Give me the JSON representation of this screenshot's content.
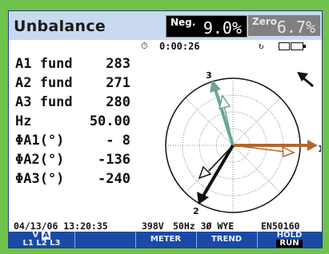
{
  "header": {
    "title": "Unbalance",
    "neg_label": "Neg.",
    "neg_value": "9.0%",
    "zero_label": "Zero",
    "zero_value": "6.7%"
  },
  "status": {
    "elapsed": "0:00:26",
    "icons": [
      "clock-icon",
      "recycle-icon",
      "plug-icon",
      "battery-icon"
    ]
  },
  "readings": [
    {
      "label": "A1 fund",
      "value": "283"
    },
    {
      "label": "A2 fund",
      "value": "271"
    },
    {
      "label": "A3 fund",
      "value": "280"
    },
    {
      "label": "Hz",
      "value": "50.00"
    },
    {
      "label": "ΦA1(°)",
      "value": "- 8"
    },
    {
      "label": "ΦA2(°)",
      "value": "-136"
    },
    {
      "label": "ΦA3(°)",
      "value": "-240"
    }
  ],
  "phasor": {
    "labels": [
      "1",
      "2",
      "3"
    ],
    "colors": {
      "phase1": "#b3662d",
      "phase2": "#111111",
      "phase3": "#6aa597"
    }
  },
  "infobar": {
    "datetime": "04/13/06 13:20:35",
    "voltage": "398V",
    "config": "50Hz 3Ø WYE",
    "standard": "EN50160"
  },
  "softkeys": {
    "k1_top": "V",
    "k1_top_active": "A",
    "k1_bottom": "L1 L2 L3",
    "k2": "",
    "k3": "METER",
    "k4": "TREND",
    "k5_top": "HOLD",
    "k5_bottom": "RUN"
  }
}
